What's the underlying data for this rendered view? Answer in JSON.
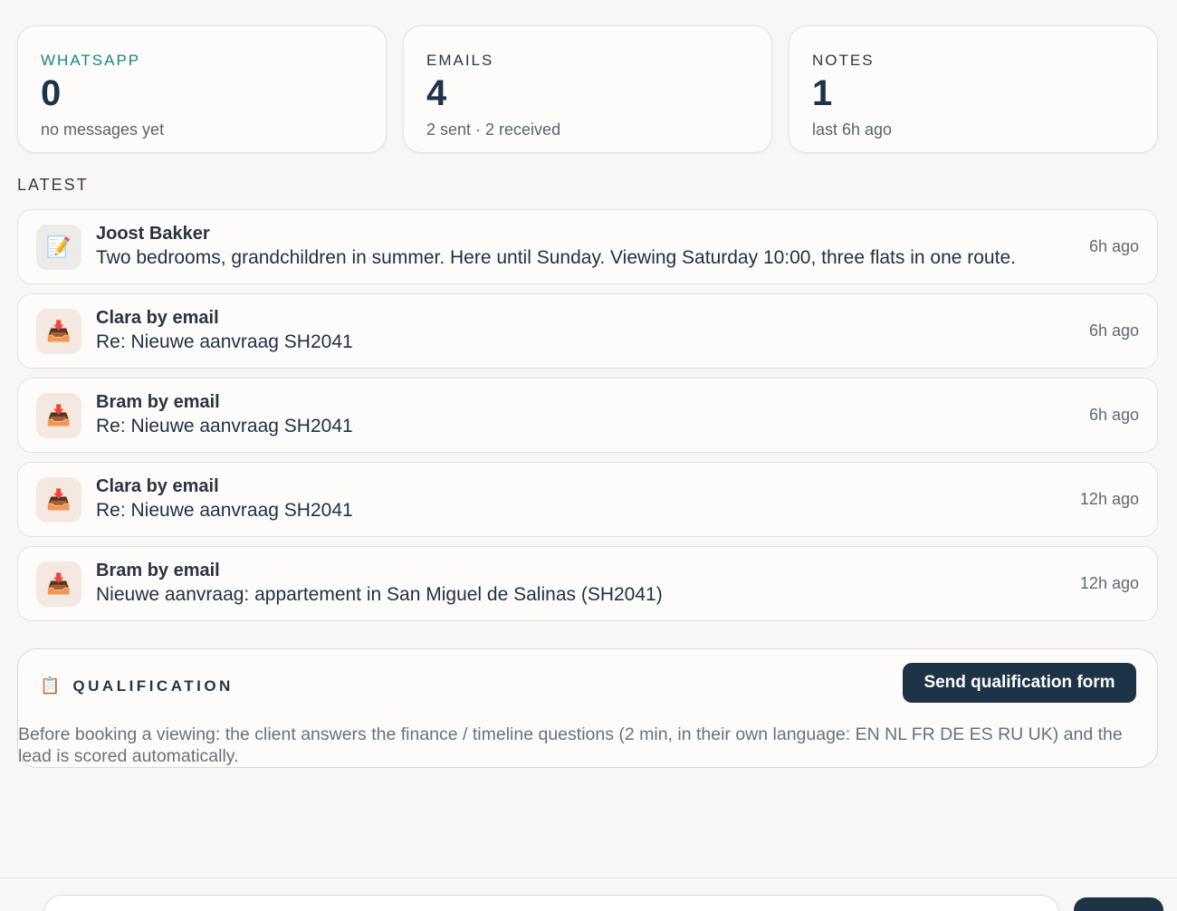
{
  "stats": [
    {
      "label": "WHATSAPP",
      "value": "0",
      "sub": "no messages yet",
      "color": "#17877a"
    },
    {
      "label": "EMAILS",
      "value": "4",
      "sub": "2 sent · 2 received"
    },
    {
      "label": "NOTES",
      "value": "1",
      "sub": "last 6h ago"
    }
  ],
  "latest": {
    "label": "LATEST",
    "items": [
      {
        "icon": "memo-icon",
        "title": "Joost Bakker",
        "text": "Two bedrooms, grandchildren in summer. Here until Sunday. Viewing Saturday 10:00, three flats in one route.",
        "time": "6h ago"
      },
      {
        "icon": "inbox-tray-icon",
        "title": "Clara by email",
        "text": "Re: Nieuwe aanvraag SH2041",
        "time": "6h ago"
      },
      {
        "icon": "inbox-tray-icon",
        "title": "Bram by email",
        "text": "Re: Nieuwe aanvraag SH2041",
        "time": "6h ago"
      },
      {
        "icon": "inbox-tray-icon",
        "title": "Clara by email",
        "text": "Re: Nieuwe aanvraag SH2041",
        "time": "12h ago"
      },
      {
        "icon": "inbox-tray-icon",
        "title": "Bram by email",
        "text": "Nieuwe aanvraag: appartement in San Miguel de Salinas (SH2041)",
        "time": "12h ago"
      }
    ]
  },
  "qualification": {
    "icon": "clipboard-icon",
    "title": "QUALIFICATION",
    "button_label": "Send qualification form",
    "description": "Before booking a viewing: the client answers the finance / timeline questions (2 min, in their own language: EN NL FR DE ES RU UK) and the lead is scored automatically."
  },
  "colors": {
    "accent_dark": "#1e3446",
    "whatsapp_green": "#17877a",
    "background": "#f8f7f5"
  }
}
